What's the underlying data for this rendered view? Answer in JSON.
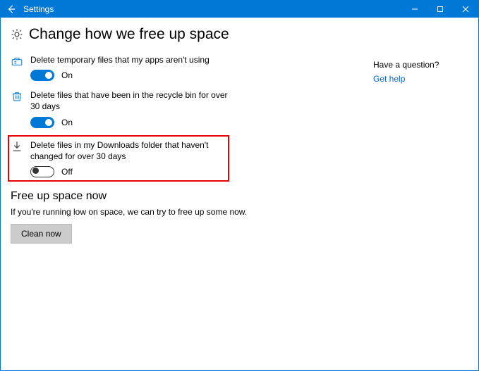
{
  "window": {
    "title": "Settings"
  },
  "page": {
    "heading": "Change how we free up space"
  },
  "settings": [
    {
      "label": "Delete temporary files that my apps aren't using",
      "state": "On",
      "on": true,
      "icon": "temp-files-icon"
    },
    {
      "label": "Delete files that have been in the recycle bin for over 30 days",
      "state": "On",
      "on": true,
      "icon": "recycle-bin-icon"
    },
    {
      "label": "Delete files in my Downloads folder that haven't changed for over 30 days",
      "state": "Off",
      "on": false,
      "icon": "download-icon",
      "highlighted": true
    }
  ],
  "freeup": {
    "heading": "Free up space now",
    "description": "If you're running low on space, we can try to free up some now.",
    "button": "Clean now"
  },
  "sidebar": {
    "question_heading": "Have a question?",
    "help_link": "Get help"
  },
  "colors": {
    "accent": "#0078d7",
    "highlight_border": "#e60000",
    "link": "#0066cc"
  }
}
